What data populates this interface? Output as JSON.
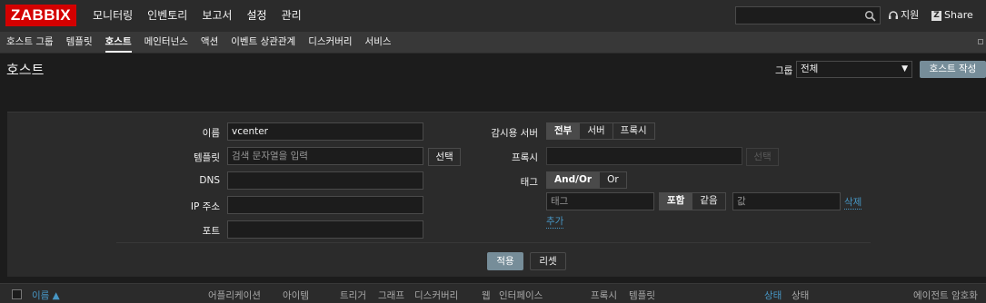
{
  "brand": {
    "logo_text": "ZABBIX",
    "logo_color": "#d40000",
    "accent": "#768d99",
    "link_color": "#4796c4"
  },
  "main_nav": [
    {
      "label": "모니터링"
    },
    {
      "label": "인벤토리"
    },
    {
      "label": "보고서"
    },
    {
      "label": "설정",
      "active": true
    },
    {
      "label": "관리"
    }
  ],
  "topbar": {
    "search_placeholder": "",
    "search_icon": "search-icon",
    "support_label": "지원",
    "share_label": "Share",
    "share_badge": "Z"
  },
  "sub_nav": [
    {
      "label": "호스트 그룹"
    },
    {
      "label": "템플릿"
    },
    {
      "label": "호스트",
      "active": true
    },
    {
      "label": "메인터넌스"
    },
    {
      "label": "액션"
    },
    {
      "label": "이벤트 상관관계"
    },
    {
      "label": "디스커버리"
    },
    {
      "label": "서비스"
    }
  ],
  "header": {
    "title": "호스트",
    "group_label": "그룹",
    "group_value": "전체",
    "create_button": "호스트 작성"
  },
  "filter": {
    "name_label": "이름",
    "name_value": "vcenter",
    "templates_label": "템플릿",
    "templates_placeholder": "검색 문자열을 입력",
    "select_button": "선택",
    "dns_label": "DNS",
    "dns_value": "",
    "ip_label": "IP 주소",
    "ip_value": "",
    "port_label": "포트",
    "port_value": "",
    "monitored_by_label": "감시용 서버",
    "monitored_by_options": [
      "전부",
      "서버",
      "프록시"
    ],
    "monitored_by_selected": "전부",
    "proxy_label": "프록시",
    "proxy_value": "",
    "proxy_select_button": "선택",
    "tags_label": "태그",
    "tags_mode_options": [
      "And/Or",
      "Or"
    ],
    "tags_mode_selected": "And/Or",
    "tag_placeholder": "태그",
    "tag_operator_options": [
      "포함",
      "같음"
    ],
    "tag_operator_selected": "포함",
    "tag_value_placeholder": "값",
    "remove_link": "삭제",
    "add_link": "추가",
    "apply_button": "적용",
    "reset_button": "리셋"
  },
  "table_headers": {
    "name": "이름 ▲",
    "applications": "어플리케이션",
    "items": "아이템",
    "triggers": "트리거",
    "graphs": "그래프",
    "discovery": "디스커버리",
    "web": "웹",
    "interface": "인터페이스",
    "proxy": "프록시",
    "templates": "템플릿",
    "status": "상태",
    "availability": "상태",
    "agent_encryption": "에이전트 암호화"
  }
}
